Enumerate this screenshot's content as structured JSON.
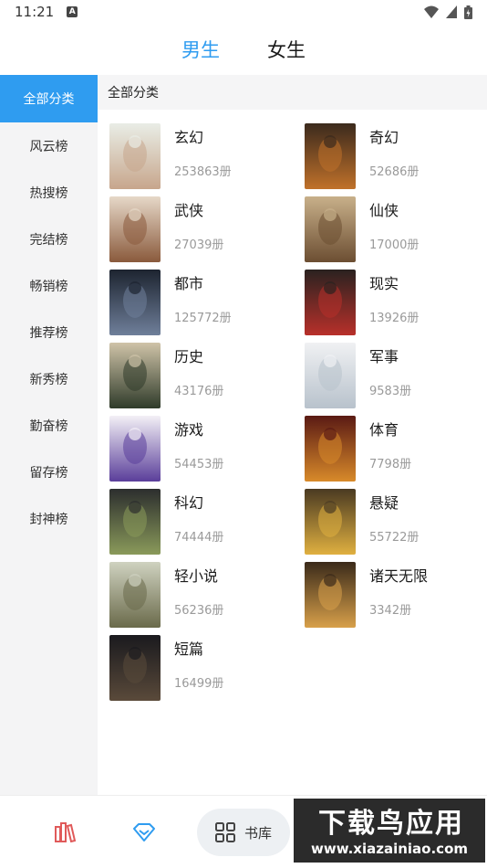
{
  "status": {
    "time": "11:21",
    "notif_glyph": "A"
  },
  "top_tabs": [
    {
      "label": "男生",
      "active": true
    },
    {
      "label": "女生",
      "active": false
    }
  ],
  "sidebar": {
    "items": [
      {
        "label": "全部分类",
        "active": true
      },
      {
        "label": "风云榜"
      },
      {
        "label": "热搜榜"
      },
      {
        "label": "完结榜"
      },
      {
        "label": "畅销榜"
      },
      {
        "label": "推荐榜"
      },
      {
        "label": "新秀榜"
      },
      {
        "label": "勤奋榜"
      },
      {
        "label": "留存榜"
      },
      {
        "label": "封神榜"
      }
    ]
  },
  "section_title": "全部分类",
  "categories": [
    {
      "name": "玄幻",
      "count": "253863册",
      "cover": {
        "bg": "#e9ede6",
        "accent": "#c7a68c",
        "title": ""
      }
    },
    {
      "name": "奇幻",
      "count": "52686册",
      "cover": {
        "bg": "#3b2a1d",
        "accent": "#c0712a",
        "title": "武道宗师"
      }
    },
    {
      "name": "武侠",
      "count": "27039册",
      "cover": {
        "bg": "#e6d8c8",
        "accent": "#8a5a3c",
        "title": ""
      }
    },
    {
      "name": "仙侠",
      "count": "17000册",
      "cover": {
        "bg": "#c8b08a",
        "accent": "#6c4e32",
        "title": ""
      }
    },
    {
      "name": "都市",
      "count": "125772册",
      "cover": {
        "bg": "#1d2430",
        "accent": "#6f7f9a",
        "title": "一个面包"
      }
    },
    {
      "name": "现实",
      "count": "13926册",
      "cover": {
        "bg": "#2a2220",
        "accent": "#b8302a",
        "title": "佣兵战争"
      }
    },
    {
      "name": "历史",
      "count": "43176册",
      "cover": {
        "bg": "#cfc3a8",
        "accent": "#2f3b2a",
        "title": ""
      }
    },
    {
      "name": "军事",
      "count": "9583册",
      "cover": {
        "bg": "#f0f1f3",
        "accent": "#b8c2cc",
        "title": ""
      }
    },
    {
      "name": "游戏",
      "count": "54453册",
      "cover": {
        "bg": "#f3f0f6",
        "accent": "#5a3e9a",
        "title": ""
      }
    },
    {
      "name": "体育",
      "count": "7798册",
      "cover": {
        "bg": "#5a1a14",
        "accent": "#d88a2a",
        "title": ""
      }
    },
    {
      "name": "科幻",
      "count": "74444册",
      "cover": {
        "bg": "#2c2e2e",
        "accent": "#8a9a5a",
        "title": ""
      }
    },
    {
      "name": "悬疑",
      "count": "55722册",
      "cover": {
        "bg": "#4a3a22",
        "accent": "#e0b040",
        "title": ""
      }
    },
    {
      "name": "轻小说",
      "count": "56236册",
      "cover": {
        "bg": "#cfd2c0",
        "accent": "#6a6a4a",
        "title": ""
      }
    },
    {
      "name": "诸天无限",
      "count": "3342册",
      "cover": {
        "bg": "#3a2a1a",
        "accent": "#d8a04a",
        "title": ""
      }
    },
    {
      "name": "短篇",
      "count": "16499册",
      "cover": {
        "bg": "#1a1a1e",
        "accent": "#5a4a3a",
        "title": ""
      }
    }
  ],
  "bottom_nav": [
    {
      "icon": "books-icon",
      "label": ""
    },
    {
      "icon": "diamond-icon",
      "label": ""
    },
    {
      "icon": "grid-icon",
      "label": "书库",
      "active": true
    }
  ],
  "watermark": {
    "big": "下载鸟应用",
    "small": "www.xiazainiao.com"
  },
  "colors": {
    "accent": "#2f9cf0",
    "sidebar_bg": "#f4f4f5",
    "count_gray": "#9a9a9a",
    "nav_red": "#e05a5a",
    "nav_blue": "#2f9cf0"
  }
}
